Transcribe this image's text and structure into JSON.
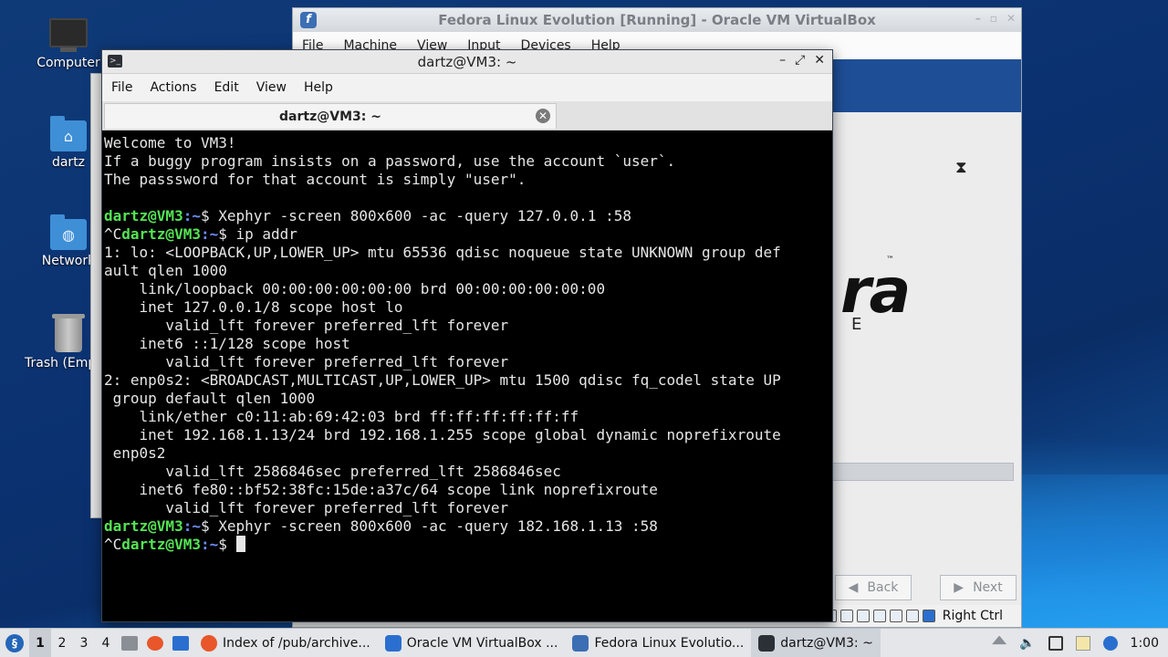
{
  "desktop": {
    "icons": [
      {
        "label": "Computer",
        "icon": "computer-icon"
      },
      {
        "label": "dartz",
        "icon": "home-folder-icon"
      },
      {
        "label": "Network",
        "icon": "network-folder-icon"
      },
      {
        "label": "Trash (Empty)",
        "icon": "trash-icon"
      }
    ]
  },
  "vbox": {
    "title": "Fedora Linux Evolution [Running] - Oracle VM VirtualBox",
    "menu": [
      "File",
      "Machine",
      "View",
      "Input",
      "Devices",
      "Help"
    ],
    "guest": {
      "brand": "ra",
      "tm": "™",
      "subtitle": "E",
      "back_label": "Back",
      "next_label": "Next"
    },
    "status": {
      "host_key": "Right Ctrl"
    }
  },
  "terminal": {
    "title": "dartz@VM3: ~",
    "menu": [
      "File",
      "Actions",
      "Edit",
      "View",
      "Help"
    ],
    "tab_title": "dartz@VM3: ~",
    "prompt_user": "dartz@VM3",
    "prompt_path": ":~",
    "prompt_sym": "$ ",
    "lines": [
      {
        "text": "Welcome to VM3!"
      },
      {
        "text": "If a buggy program insists on a password, use the account `user`."
      },
      {
        "text": "The passsword for that account is simply \"user\"."
      },
      {
        "text": ""
      },
      {
        "prompt": true,
        "prefix": "",
        "text": "Xephyr -screen 800x600 -ac -query 127.0.0.1 :58"
      },
      {
        "prompt": true,
        "prefix": "^C",
        "text": "ip addr"
      },
      {
        "text": "1: lo: <LOOPBACK,UP,LOWER_UP> mtu 65536 qdisc noqueue state UNKNOWN group def"
      },
      {
        "text": "ault qlen 1000"
      },
      {
        "text": "    link/loopback 00:00:00:00:00:00 brd 00:00:00:00:00:00"
      },
      {
        "text": "    inet 127.0.0.1/8 scope host lo"
      },
      {
        "text": "       valid_lft forever preferred_lft forever"
      },
      {
        "text": "    inet6 ::1/128 scope host"
      },
      {
        "text": "       valid_lft forever preferred_lft forever"
      },
      {
        "text": "2: enp0s2: <BROADCAST,MULTICAST,UP,LOWER_UP> mtu 1500 qdisc fq_codel state UP"
      },
      {
        "text": " group default qlen 1000"
      },
      {
        "text": "    link/ether c0:11:ab:69:42:03 brd ff:ff:ff:ff:ff:ff"
      },
      {
        "text": "    inet 192.168.1.13/24 brd 192.168.1.255 scope global dynamic noprefixroute"
      },
      {
        "text": " enp0s2"
      },
      {
        "text": "       valid_lft 2586846sec preferred_lft 2586846sec"
      },
      {
        "text": "    inet6 fe80::bf52:38fc:15de:a37c/64 scope link noprefixroute"
      },
      {
        "text": "       valid_lft forever preferred_lft forever"
      },
      {
        "prompt": true,
        "prefix": "",
        "text": "Xephyr -screen 800x600 -ac -query 182.168.1.13 :58"
      },
      {
        "prompt": true,
        "prefix": "^C",
        "text": "",
        "cursor": true
      }
    ]
  },
  "taskbar": {
    "workspaces": [
      "1",
      "2",
      "3",
      "4"
    ],
    "active_workspace": "1",
    "tasks": [
      {
        "label": "Index of /pub/archive...",
        "icon": "firefox-icon",
        "color": "#e8562a"
      },
      {
        "label": "Oracle VM VirtualBox ...",
        "icon": "virtualbox-icon",
        "color": "#2a6fcf"
      },
      {
        "label": "Fedora Linux Evolutio...",
        "icon": "fedora-icon",
        "color": "#3c6eb4"
      },
      {
        "label": "dartz@VM3: ~",
        "icon": "terminal-icon",
        "color": "#2b2f36"
      }
    ],
    "clock": "1:00"
  },
  "colors": {
    "prompt_user": "#54e354",
    "prompt_path": "#6f8fff",
    "terminal_bg": "#000000",
    "terminal_fg": "#e6e6e6",
    "desktop_bg": "#0b3170"
  }
}
